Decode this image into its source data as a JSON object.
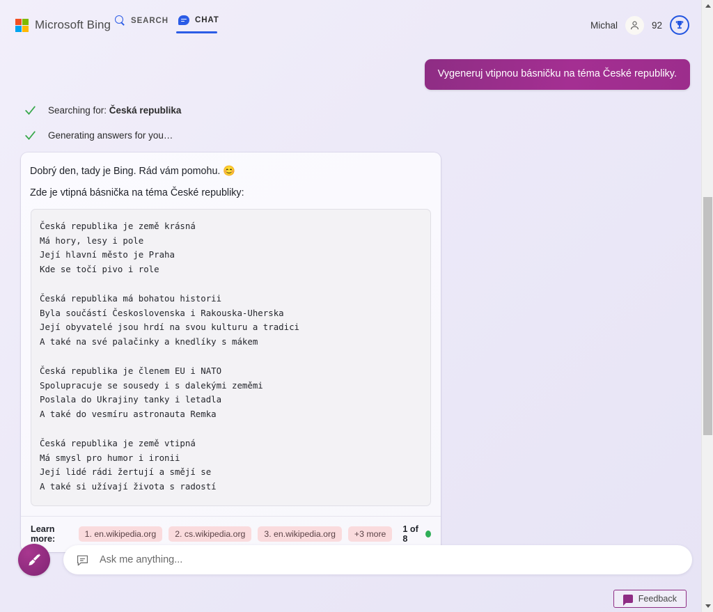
{
  "header": {
    "brand": "Microsoft Bing",
    "tabs": [
      {
        "label": "SEARCH",
        "icon": "search-icon",
        "active": false
      },
      {
        "label": "CHAT",
        "icon": "chat-bubble-icon",
        "active": true
      }
    ],
    "user_name": "Michal",
    "points": "92",
    "avatar_icon": "person-icon",
    "rewards_icon": "trophy-icon"
  },
  "conversation": {
    "user_message": "Vygeneruj vtipnou básničku na téma České republiky.",
    "status": [
      {
        "icon": "checkmark-icon",
        "prefix": "Searching for: ",
        "query": "Česká republika"
      },
      {
        "icon": "checkmark-icon",
        "prefix": "Generating answers for you…",
        "query": ""
      }
    ],
    "answer": {
      "greeting": "Dobrý den, tady je Bing. Rád vám pomohu.  😊",
      "intro": "Zde je vtipná básnička na téma České republiky:",
      "poem": "Česká republika je země krásná\nMá hory, lesy i pole\nJejí hlavní město je Praha\nKde se točí pivo i role\n\nČeská republika má bohatou historii\nByla součástí Československa i Rakouska-Uherska\nJejí obyvatelé jsou hrdí na svou kulturu a tradici\nA také na své palačinky a knedlíky s mákem\n\nČeská republika je členem EU i NATO\nSpolupracuje se sousedy i s dalekými zeměmi\nPoslala do Ukrajiny tanky i letadla\nA také do vesmíru astronauta Remka\n\nČeská republika je země vtipná\nMá smysl pro humor i ironii\nJejí lidé rádi žertují a smějí se\nA také si užívají života s radostí",
      "learn_more_label": "Learn more:",
      "sources": [
        "1. en.wikipedia.org",
        "2. cs.wikipedia.org",
        "3. en.wikipedia.org"
      ],
      "more_sources": "+3 more",
      "page_count": "1 of 8"
    }
  },
  "composer": {
    "new_topic_icon": "broom-icon",
    "input_icon": "chat-bubble-outline-icon",
    "placeholder": "Ask me anything...",
    "value": ""
  },
  "feedback": {
    "label": "Feedback",
    "icon": "feedback-bubble-icon"
  },
  "colors": {
    "accent_blue": "#2b5ce6",
    "bing_purple": "#8e2d84",
    "chip_pink": "#fadbdd",
    "status_green": "#2fae57",
    "page_bg": "#ece9f7"
  }
}
